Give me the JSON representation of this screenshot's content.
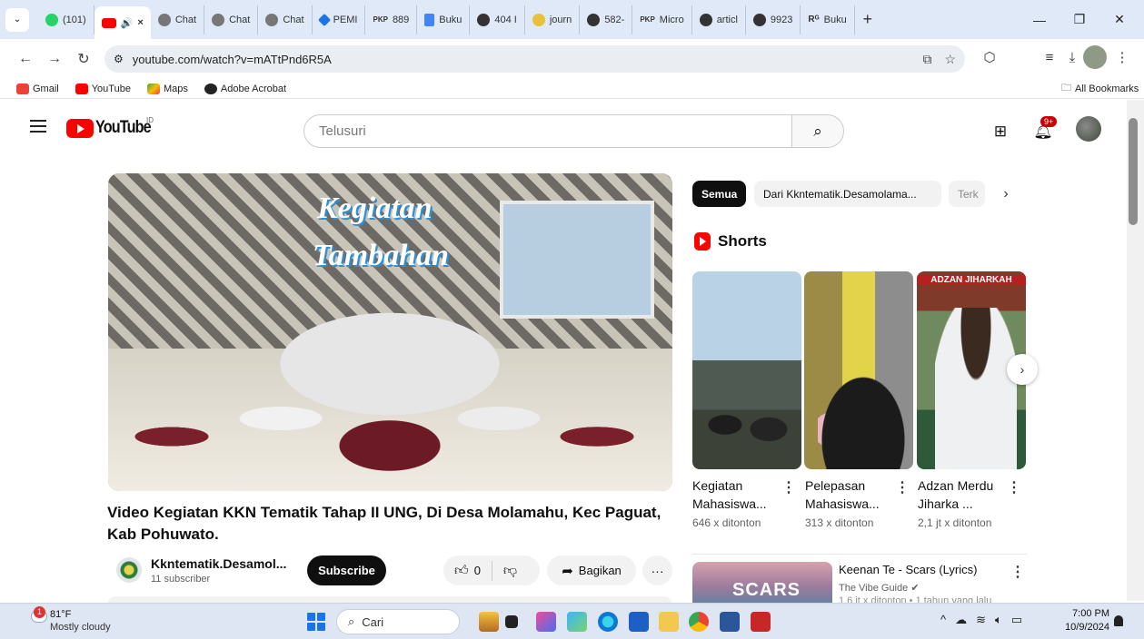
{
  "browser": {
    "tabs": [
      {
        "label": "(101)",
        "color": "#25d366"
      },
      {
        "label": "",
        "color": "#ff0000"
      },
      {
        "label": "Chat",
        "color": "#555555"
      },
      {
        "label": "Chat",
        "color": "#555555"
      },
      {
        "label": "Chat",
        "color": "#555555"
      },
      {
        "label": "PEMI",
        "color": "#1a73e8"
      },
      {
        "label": "889",
        "color": "#333333"
      },
      {
        "label": "Buku",
        "color": "#4285f4"
      },
      {
        "label": "404 I",
        "color": "#333333"
      },
      {
        "label": "journ",
        "color": "#e8c13a"
      },
      {
        "label": "582-",
        "color": "#333333"
      },
      {
        "label": "Micro",
        "color": "#333333"
      },
      {
        "label": "articl",
        "color": "#333333"
      },
      {
        "label": "9923",
        "color": "#333333"
      },
      {
        "label": "Buku",
        "color": "#333333"
      }
    ],
    "url": "youtube.com/watch?v=mATtPnd6R5A",
    "bookmarks": [
      "Gmail",
      "YouTube",
      "Maps",
      "Adobe Acrobat"
    ],
    "all_bookmarks": "All Bookmarks"
  },
  "youtube": {
    "logo_text": "YouTube",
    "country": "ID",
    "search_placeholder": "Telusuri",
    "notif_count": "9+"
  },
  "video": {
    "overlay_line1": "Kegiatan",
    "overlay_line2": "Tambahan",
    "title": "Video Kegiatan KKN Tematik Tahap II UNG, Di Desa Molamahu, Kec Paguat, Kab Pohuwato.",
    "channel_name": "Kkntematik.Desamol...",
    "subscribers": "11 subscriber",
    "subscribe_label": "Subscribe",
    "likes": "0",
    "share_label": "Bagikan"
  },
  "sidebar": {
    "chips": [
      "Semua",
      "Dari Kkntematik.Desamolama...",
      "Terk"
    ],
    "shorts_title": "Shorts",
    "shorts": [
      {
        "title_1": "Kegiatan",
        "title_2": "Mahasiswa...",
        "views": "646 x ditonton"
      },
      {
        "title_1": "Pelepasan",
        "title_2": "Mahasiswa...",
        "views": "313 x ditonton"
      },
      {
        "title_1": "Adzan Merdu",
        "title_2": "Jiharka ...",
        "views": "2,1 jt x ditonton",
        "overlay": "ADZAN JIHARKAH"
      }
    ],
    "related": {
      "thumb_text": "SCARS",
      "title": "Keenan Te - Scars (Lyrics)",
      "channel": "The Vibe Guide",
      "meta": "1,6 jt x ditonton • 1 tahun yang lalu"
    }
  },
  "taskbar": {
    "weather_badge": "1",
    "temperature": "81°F",
    "condition": "Mostly cloudy",
    "search_label": "Cari",
    "time": "7:00 PM",
    "date": "10/9/2024"
  }
}
